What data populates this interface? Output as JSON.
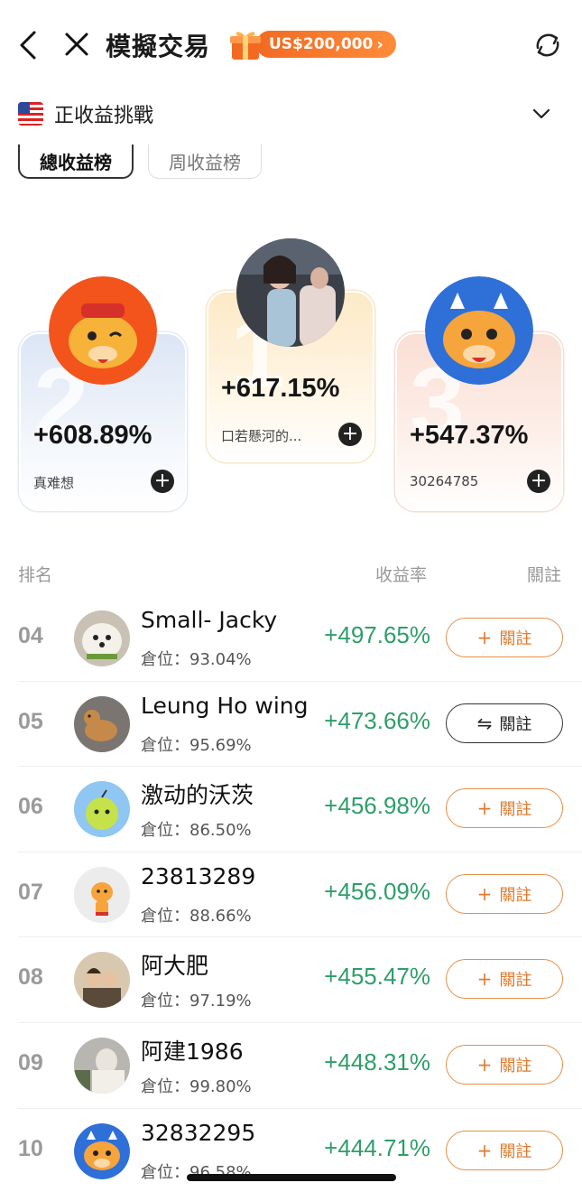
{
  "header": {
    "title": "模擬交易",
    "promo_label": "US$200,000",
    "promo_chevron": "›"
  },
  "challenge": {
    "flag": "us-flag-icon",
    "label": "正收益挑戰"
  },
  "tabs": [
    {
      "label": "總收益榜",
      "active": true
    },
    {
      "label": "周收益榜",
      "active": false
    }
  ],
  "podium": {
    "first": {
      "rank_glyph": "1",
      "return": "+617.15%",
      "name": "口若懸河的..."
    },
    "second": {
      "rank_glyph": "2",
      "return": "+608.89%",
      "name": "真难想"
    },
    "third": {
      "rank_glyph": "3",
      "return": "+547.37%",
      "name": "30264785"
    }
  },
  "list_header": {
    "rank": "排名",
    "return": "收益率",
    "follow": "關註"
  },
  "position_prefix": "倉位：",
  "rows": [
    {
      "rank": "04",
      "name": "Small- Jacky",
      "position": "93.04%",
      "return": "+497.65%",
      "follow_label": "關註",
      "following": false
    },
    {
      "rank": "05",
      "name": "Leung Ho wing",
      "position": "95.69%",
      "return": "+473.66%",
      "follow_label": "關註",
      "following": true
    },
    {
      "rank": "06",
      "name": "激动的沃茨",
      "position": "86.50%",
      "return": "+456.98%",
      "follow_label": "關註",
      "following": false
    },
    {
      "rank": "07",
      "name": "23813289",
      "position": "88.66%",
      "return": "+456.09%",
      "follow_label": "關註",
      "following": false
    },
    {
      "rank": "08",
      "name": "阿大肥",
      "position": "97.19%",
      "return": "+455.47%",
      "follow_label": "關註",
      "following": false
    },
    {
      "rank": "09",
      "name": "阿建1986",
      "position": "99.80%",
      "return": "+448.31%",
      "follow_label": "關註",
      "following": false
    },
    {
      "rank": "10",
      "name": "32832295",
      "position": "96.58%",
      "return": "+444.71%",
      "follow_label": "關註",
      "following": false
    }
  ],
  "colors": {
    "accent": "#f26a22",
    "positive": "#2f9e6a",
    "follow_border": "#e58f47"
  }
}
